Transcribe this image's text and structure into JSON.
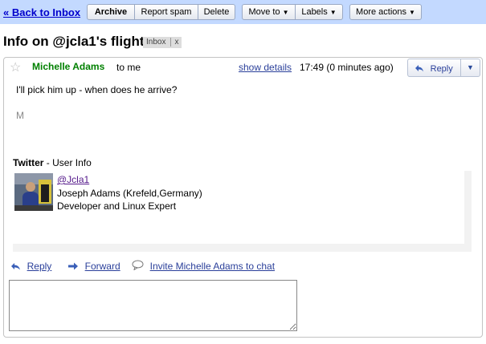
{
  "toolbar": {
    "back_label": "« Back to Inbox",
    "archive_label": "Archive",
    "report_spam_label": "Report spam",
    "delete_label": "Delete",
    "move_to_label": "Move to",
    "labels_label": "Labels",
    "more_actions_label": "More actions",
    "dropdown_arrow": "▼"
  },
  "thread": {
    "subject": "Info on @jcla1's flight",
    "label": "Inbox",
    "label_remove": "x"
  },
  "message": {
    "star": "☆",
    "sender": "Michelle Adams",
    "recipient": "to me",
    "show_details": "show details",
    "time": "17:49 (0 minutes ago)",
    "reply_label": "Reply",
    "more_arrow": "▼",
    "body": "I'll pick him up - when does he arrive?",
    "signature": "M"
  },
  "twitter": {
    "title_brand": "Twitter",
    "title_rest": " - User Info",
    "handle": "@Jcla1",
    "name": "Joseph Adams (Krefeld,Germany)",
    "description": "Developer and Linux Expert"
  },
  "actions": {
    "reply": "Reply",
    "forward": "Forward",
    "invite": "Invite Michelle Adams to chat"
  },
  "icons": {
    "reply": "reply-arrow-icon",
    "forward": "forward-arrow-icon",
    "chat": "chat-bubble-icon",
    "star": "star-icon"
  },
  "colors": {
    "toolbar_bg": "#c3d9ff",
    "sender": "#008000",
    "link": "#2a3f9a"
  }
}
